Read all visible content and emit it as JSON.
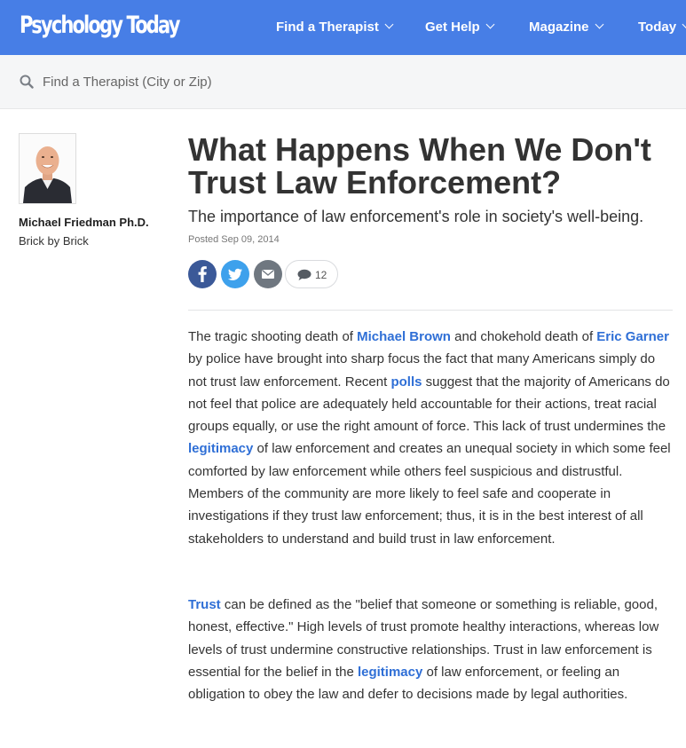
{
  "header": {
    "logo_text": "Psychology Today",
    "nav": [
      {
        "label": "Find a Therapist"
      },
      {
        "label": "Get Help"
      },
      {
        "label": "Magazine"
      },
      {
        "label": "Today"
      }
    ]
  },
  "search": {
    "placeholder": "Find a Therapist (City or Zip)",
    "value": ""
  },
  "author": {
    "name": "Michael Friedman Ph.D.",
    "blog": "Brick by Brick"
  },
  "article": {
    "title": "What Happens When We Don't Trust Law Enforcement?",
    "subtitle": "The importance of law enforcement's role in society's well-being.",
    "posted": "Posted Sep 09, 2014",
    "comment_count": "12",
    "p1": {
      "t1": "The tragic shooting death of ",
      "l1": "Michael Brown",
      "t2": " and chokehold death of ",
      "l2": "Eric Garner",
      "t3": " by police have brought into sharp focus the fact that many Americans simply do not trust law enforcement. Recent ",
      "l3": "polls",
      "t4": " suggest that the majority of Americans do not feel that police are adequately held accountable for their actions, treat racial groups equally, or use the right amount of force. This lack of trust undermines the ",
      "l4": "legitimacy",
      "t5": " of law enforcement and creates an unequal society in which some feel comforted by law enforcement while others feel suspicious and distrustful. Members of the community are more likely to feel safe and cooperate in investigations if they trust law enforcement; thus, it is in the best interest of all stakeholders to understand and build trust in law enforcement."
    },
    "p2": {
      "l1": "Trust",
      "t1": " can be defined as the \"belief that someone or something is reliable, good, honest, effective.\" High levels of trust promote healthy interactions, whereas low levels of trust undermine constructive relationships. Trust in law enforcement is essential for the belief in the ",
      "l2": "legitimacy",
      "t2": " of law enforcement, or feeling an obligation to obey the law and defer to decisions made by legal authorities."
    }
  },
  "colors": {
    "brand_blue": "#477ee6",
    "link_blue": "#2f6fd6",
    "facebook": "#3b5998",
    "twitter": "#3ea1ec",
    "email": "#6f7780"
  },
  "icons": {
    "search": "search-icon",
    "facebook": "facebook-icon",
    "twitter": "twitter-icon",
    "email": "email-icon",
    "comment": "comment-icon",
    "chevron": "chevron-down-icon"
  }
}
